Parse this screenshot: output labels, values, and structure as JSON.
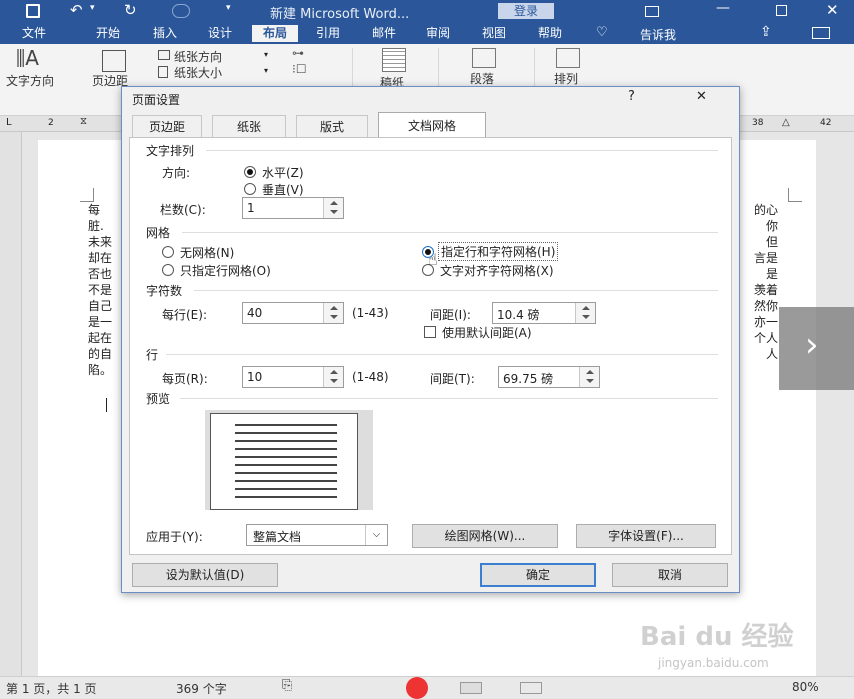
{
  "window": {
    "title": "新建 Microsoft Word...",
    "login": "登录",
    "tabs": [
      "文件",
      "开始",
      "插入",
      "设计",
      "布局",
      "引用",
      "邮件",
      "审阅",
      "视图",
      "帮助"
    ],
    "tellme": "告诉我"
  },
  "ribbon": {
    "text_direction": "文字方向",
    "margins": "页边距",
    "orientation": "纸张方向",
    "size": "纸张大小",
    "draft": "稿纸",
    "paragraph": "段落",
    "arrange": "排列"
  },
  "ruler": {
    "marks": [
      "2",
      "38",
      "42"
    ]
  },
  "document": {
    "left_chars": [
      "每",
      "脏.",
      "未来",
      "却在",
      "否也",
      "不是",
      "自己",
      "是一",
      "起在",
      "的自",
      "陷。"
    ],
    "right_chars": [
      "的心",
      "你",
      "但",
      "言是",
      "是",
      "羡着",
      "然你",
      "亦一",
      "个人",
      "人"
    ]
  },
  "dialog": {
    "title": "页面设置",
    "help": "?",
    "close": "✕",
    "tabs": [
      "页边距",
      "纸张",
      "版式",
      "文档网格"
    ],
    "active_tab": 3,
    "text_arrange": {
      "label": "文字排列",
      "direction_label": "方向:",
      "horizontal": "水平(Z)",
      "vertical": "垂直(V)",
      "columns_label": "栏数(C):",
      "columns_value": "1"
    },
    "grid": {
      "label": "网格",
      "none": "无网格(N)",
      "lines_only": "只指定行网格(O)",
      "lines_and_chars": "指定行和字符网格(H)",
      "snap_chars": "文字对齐字符网格(X)"
    },
    "chars": {
      "label": "字符数",
      "per_line_label": "每行(E):",
      "per_line_value": "40",
      "range": "(1-43)",
      "pitch_label": "间距(I):",
      "pitch_value": "10.4 磅",
      "default_pitch": "使用默认间距(A)"
    },
    "lines": {
      "label": "行",
      "per_page_label": "每页(R):",
      "per_page_value": "10",
      "range": "(1-48)",
      "pitch_label": "间距(T):",
      "pitch_value": "69.75 磅"
    },
    "preview_label": "预览",
    "apply_label": "应用于(Y):",
    "apply_value": "整篇文档",
    "draw_grid": "绘图网格(W)...",
    "font_settings": "字体设置(F)...",
    "set_default": "设为默认值(D)",
    "ok": "确定",
    "cancel": "取消"
  },
  "status": {
    "page": "第 1 页，共 1 页",
    "words": "369 个字",
    "zoom": "80%"
  },
  "watermark": {
    "brand": "Bai du 经验",
    "url": "jingyan.baidu.com"
  },
  "colors": {
    "word_blue": "#2b579a",
    "dialog_border": "#6b8ec4",
    "radio_selected": "#1a6fc9"
  }
}
